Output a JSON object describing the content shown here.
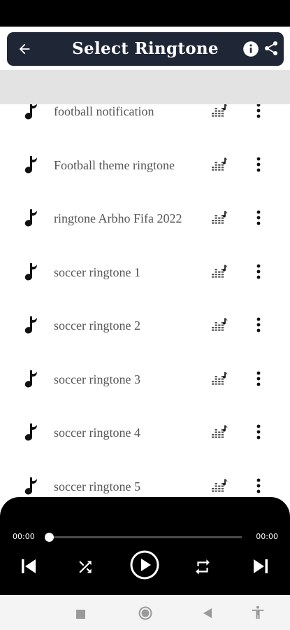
{
  "app_bar": {
    "title": "Select Ringtone",
    "back_icon": "arrow-left-icon",
    "info_icon": "info-icon",
    "share_icon": "share-icon",
    "background": "#1f2636"
  },
  "ringtones": [
    {
      "name": "football notification"
    },
    {
      "name": "Football theme ringtone"
    },
    {
      "name": "ringtone Arbho Fifa 2022"
    },
    {
      "name": "soccer ringtone 1"
    },
    {
      "name": "soccer ringtone 2"
    },
    {
      "name": "soccer ringtone 3"
    },
    {
      "name": "soccer ringtone 4"
    },
    {
      "name": "soccer ringtone 5"
    }
  ],
  "row_icons": {
    "leading": "music-note-icon",
    "set_ringtone": "equalizer-icon",
    "menu": "more-vertical-icon"
  },
  "player": {
    "current_time": "00:00",
    "total_time": "00:00",
    "progress": 0,
    "controls": [
      "skip-previous-icon",
      "shuffle-icon",
      "play-icon",
      "repeat-icon",
      "skip-next-icon"
    ]
  },
  "nav_bar": {
    "icons": [
      "recents-square-icon",
      "home-circle-icon",
      "back-triangle-icon",
      "accessibility-icon"
    ]
  }
}
